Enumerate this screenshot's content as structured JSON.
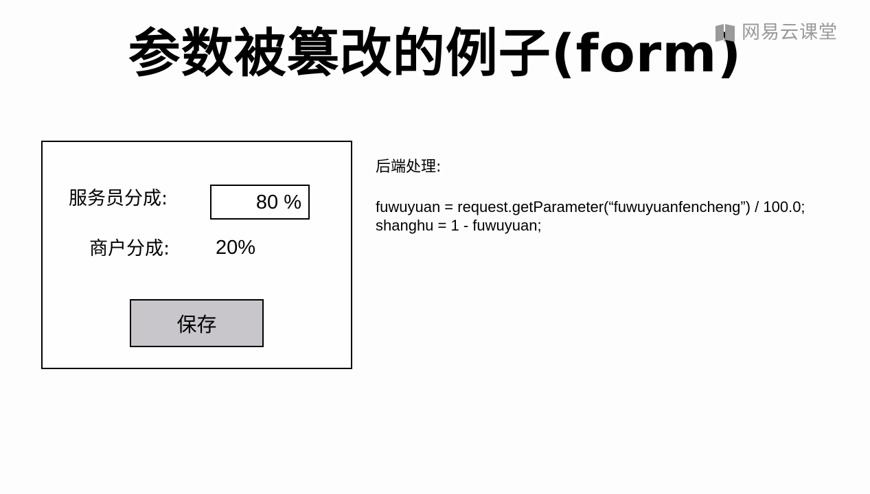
{
  "slide": {
    "title": "参数被篡改的例子(form)"
  },
  "watermark": {
    "brand": "网易云课堂",
    "icon": "book-icon",
    "color": "#9a9a9a"
  },
  "form": {
    "waiter_label": "服务员分成:",
    "waiter_value": "80 %",
    "merchant_label": "商户分成:",
    "merchant_value": "20%",
    "save_label": "保存",
    "save_button_color": "#c8c6cb"
  },
  "backend": {
    "heading": "后端处理:",
    "code_lines": [
      "fuwuyuan = request.getParameter(“fuwuyuanfencheng”) / 100.0;",
      "shanghu = 1 - fuwuyuan;"
    ]
  }
}
